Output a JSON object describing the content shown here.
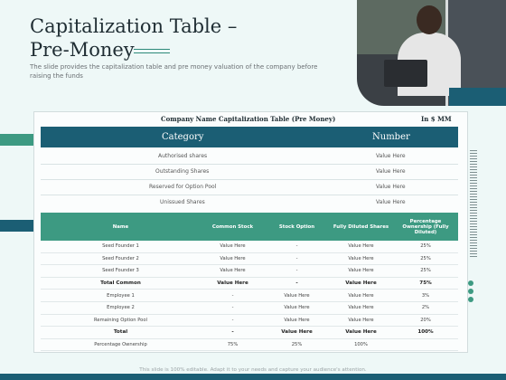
{
  "slide": {
    "title_line1": "Capitalization Table –",
    "title_line2": "Pre-Money",
    "subtitle": "The slide provides the capitalization table and pre money valuation of the company before raising the funds",
    "footer": "This slide is 100% editable. Adapt it to your needs and capture your audience's attention."
  },
  "table": {
    "heading": "Company Name Capitalization Table (Pre Money)",
    "unit": "In $ MM"
  },
  "category": {
    "header_left": "Category",
    "header_right": "Number",
    "rows": [
      {
        "label": "Authorised shares",
        "value": "Value Here"
      },
      {
        "label": "Outstanding Shares",
        "value": "Value Here"
      },
      {
        "label": "Reserved for Option Pool",
        "value": "Value Here"
      },
      {
        "label": "Unissued Shares",
        "value": "Value Here"
      }
    ]
  },
  "main": {
    "columns": [
      "Name",
      "Common Stock",
      "Stock Option",
      "Fully Diluted Shares",
      "Percentage Ownership (Fully Diluted)"
    ],
    "rows": [
      {
        "cells": [
          "Seed Founder 1",
          "Value Here",
          "-",
          "Value Here",
          "25%"
        ],
        "bold": false
      },
      {
        "cells": [
          "Seed Founder 2",
          "Value Here",
          "-",
          "Value Here",
          "25%"
        ],
        "bold": false
      },
      {
        "cells": [
          "Seed Founder 3",
          "Value Here",
          "-",
          "Value Here",
          "25%"
        ],
        "bold": false
      },
      {
        "cells": [
          "Total Common",
          "Value Here",
          "-",
          "Value Here",
          "75%"
        ],
        "bold": true
      },
      {
        "cells": [
          "Employee 1",
          "-",
          "Value Here",
          "Value Here",
          "3%"
        ],
        "bold": false
      },
      {
        "cells": [
          "Employee 2",
          "-",
          "Value Here",
          "Value Here",
          "2%"
        ],
        "bold": false
      },
      {
        "cells": [
          "Remaining Option Pool",
          "-",
          "Value Here",
          "Value Here",
          "20%"
        ],
        "bold": false
      },
      {
        "cells": [
          "Total",
          "-",
          "Value Here",
          "Value Here",
          "100%"
        ],
        "bold": true
      },
      {
        "cells": [
          "Percentage Ownership",
          "75%",
          "25%",
          "100%",
          ""
        ],
        "bold": false
      }
    ]
  },
  "colors": {
    "dark_teal": "#1b5e74",
    "green_teal": "#3d9a82",
    "background": "#eef8f7"
  }
}
